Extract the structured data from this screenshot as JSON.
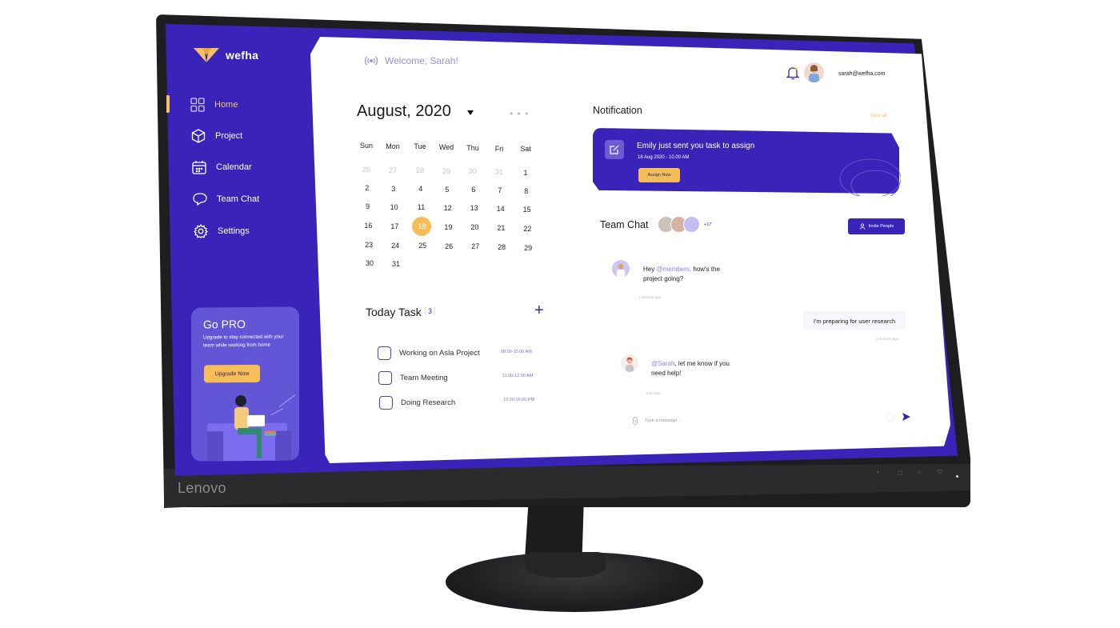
{
  "device": {
    "brand": "Lenovo",
    "control_buttons": [
      "menu",
      "power-mode",
      "input",
      "brightness",
      "power"
    ]
  },
  "app": {
    "name": "wefha",
    "brand_color": "#3a23b8",
    "accent_color": "#f5c067"
  },
  "sidebar": {
    "items": [
      {
        "label": "Home",
        "icon": "grid-icon",
        "active": true
      },
      {
        "label": "Project",
        "icon": "cube-icon",
        "active": false
      },
      {
        "label": "Calendar",
        "icon": "calendar-icon",
        "active": false
      },
      {
        "label": "Team Chat",
        "icon": "chat-bubbles-icon",
        "active": false
      },
      {
        "label": "Settings",
        "icon": "gear-icon",
        "active": false
      }
    ],
    "promo": {
      "title": "Go PRO",
      "description": "Upgrade to stay connected with your team while working from home",
      "button_label": "Upgrade Now"
    }
  },
  "header": {
    "welcome": "Welcome, Sarah!",
    "user_email": "sarah@wefha.com"
  },
  "calendar": {
    "month_label": "August, 2020",
    "more_label": "• • •",
    "weekdays": [
      "Sun",
      "Mon",
      "Tue",
      "Wed",
      "Thu",
      "Fri",
      "Sat"
    ],
    "weeks": [
      [
        {
          "d": "26",
          "m": true
        },
        {
          "d": "27",
          "m": true
        },
        {
          "d": "28",
          "m": true
        },
        {
          "d": "29",
          "m": true
        },
        {
          "d": "30",
          "m": true
        },
        {
          "d": "31",
          "m": true
        },
        {
          "d": "1"
        }
      ],
      [
        {
          "d": "2"
        },
        {
          "d": "3"
        },
        {
          "d": "4"
        },
        {
          "d": "5"
        },
        {
          "d": "6"
        },
        {
          "d": "7"
        },
        {
          "d": "8"
        }
      ],
      [
        {
          "d": "9"
        },
        {
          "d": "10"
        },
        {
          "d": "11"
        },
        {
          "d": "12"
        },
        {
          "d": "13"
        },
        {
          "d": "14"
        },
        {
          "d": "15"
        }
      ],
      [
        {
          "d": "16"
        },
        {
          "d": "17"
        },
        {
          "d": "18",
          "selected": true
        },
        {
          "d": "19"
        },
        {
          "d": "20"
        },
        {
          "d": "21"
        },
        {
          "d": "22"
        }
      ],
      [
        {
          "d": "23"
        },
        {
          "d": "24"
        },
        {
          "d": "25"
        },
        {
          "d": "26"
        },
        {
          "d": "27"
        },
        {
          "d": "28"
        },
        {
          "d": "29"
        }
      ],
      [
        {
          "d": "30"
        },
        {
          "d": "31"
        }
      ]
    ],
    "selected_day": "18"
  },
  "tasks": {
    "title": "Today Task",
    "count": "3",
    "add_label": "+",
    "items": [
      {
        "name": "Working on Asla Project",
        "time": "08.00-10.00 AM",
        "done": false
      },
      {
        "name": "Team Meeting",
        "time": "11.00-12.00 AM",
        "done": false
      },
      {
        "name": "Doing Research",
        "time": "13.00-16.00 PM",
        "done": false
      }
    ]
  },
  "notification": {
    "title": "Notification",
    "view_all": "View all",
    "card": {
      "message": "Emily just sent you task to assign",
      "datetime": "18 Aug 2020 - 10.00 AM",
      "button_label": "Assign Now"
    }
  },
  "team_chat": {
    "title": "Team Chat",
    "more_members": "+17",
    "invite_label": "Invite People",
    "messages": [
      {
        "prefix": "Hey ",
        "mention": "@members,",
        "text": " how's the project going?",
        "time": "3 minutes ago",
        "side": "left"
      },
      {
        "text": "I'm preparing for user research",
        "time": "2 minutes ago",
        "side": "right"
      },
      {
        "prefix": "",
        "mention": "@Sarah",
        "text": ", let me know if you need help!",
        "time": "Just now",
        "side": "left"
      }
    ],
    "composer_placeholder": "Type a message..."
  }
}
